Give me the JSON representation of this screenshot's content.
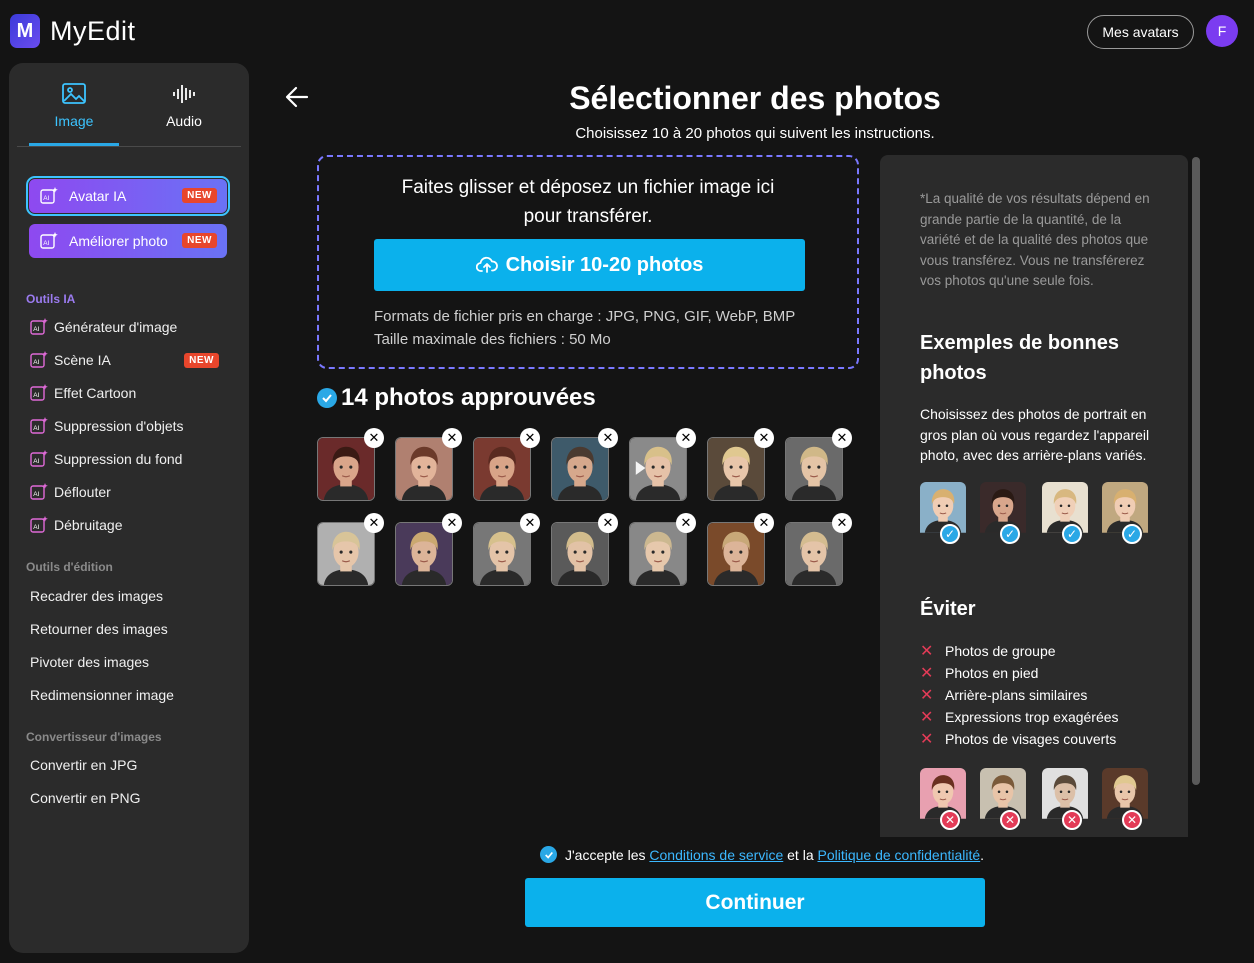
{
  "app": {
    "logo_letter": "M",
    "brand": "MyEdit"
  },
  "header": {
    "avatars_button": "Mes avatars",
    "user_initial": "F"
  },
  "sidebar": {
    "tabs": [
      {
        "label": "Image",
        "icon": "image-icon",
        "active": true
      },
      {
        "label": "Audio",
        "icon": "audio-wave-icon",
        "active": false
      }
    ],
    "featured": [
      {
        "label": "Avatar IA",
        "badge": "NEW",
        "selected": true
      },
      {
        "label": "Améliorer photo",
        "badge": "NEW",
        "selected": false
      }
    ],
    "section_ai": "Outils IA",
    "ai_tools": [
      {
        "label": "Générateur d'image"
      },
      {
        "label": "Scène IA",
        "badge": "NEW"
      },
      {
        "label": "Effet Cartoon"
      },
      {
        "label": "Suppression d'objets"
      },
      {
        "label": "Suppression du fond"
      },
      {
        "label": "Déflouter"
      },
      {
        "label": "Débruitage"
      }
    ],
    "section_edit": "Outils d'édition",
    "edit_tools": [
      "Recadrer des images",
      "Retourner des images",
      "Pivoter des images",
      "Redimensionner image"
    ],
    "section_convert": "Convertisseur d'images",
    "convert_tools": [
      "Convertir en JPG",
      "Convertir en PNG"
    ]
  },
  "main": {
    "title": "Sélectionner des photos",
    "subtitle": "Choisissez 10 à 20 photos qui suivent les instructions.",
    "dropzone": {
      "line1": "Faites glisser et déposez un fichier image ici",
      "line2": "pour transférer.",
      "button": "Choisir 10-20 photos",
      "formats": "Formats de fichier pris en charge : JPG, PNG, GIF, WebP, BMP",
      "max_size": "Taille maximale des fichiers : 50 Mo"
    },
    "approved_label": "14 photos approuvées",
    "approved_count": 14
  },
  "panel": {
    "note": "*La qualité de vos résultats dépend en grande partie de la quantité, de la variété et de la qualité des photos que vous transférez. Vous ne transférerez vos photos qu'une seule fois.",
    "good_heading": "Exemples de bonnes photos",
    "good_text": "Choisissez des photos de portrait en gros plan où vous regardez l'appareil photo, avec des arrière-plans variés.",
    "avoid_heading": "Éviter",
    "avoid_items": [
      "Photos de groupe",
      "Photos en pied",
      "Arrière-plans similaires",
      "Expressions trop exagérées",
      "Photos de visages couverts"
    ]
  },
  "footer": {
    "terms_prefix": "J'accepte les",
    "terms_link": "Conditions de service",
    "terms_mid": "et la",
    "privacy_link": "Politique de confidentialité",
    "terms_suffix": ".",
    "continue": "Continuer"
  },
  "colors": {
    "accent": "#0bb1ec",
    "purple_start": "#8e49f0",
    "purple_end": "#6a72f5",
    "danger": "#e33b57",
    "badge": "#e8462c"
  }
}
